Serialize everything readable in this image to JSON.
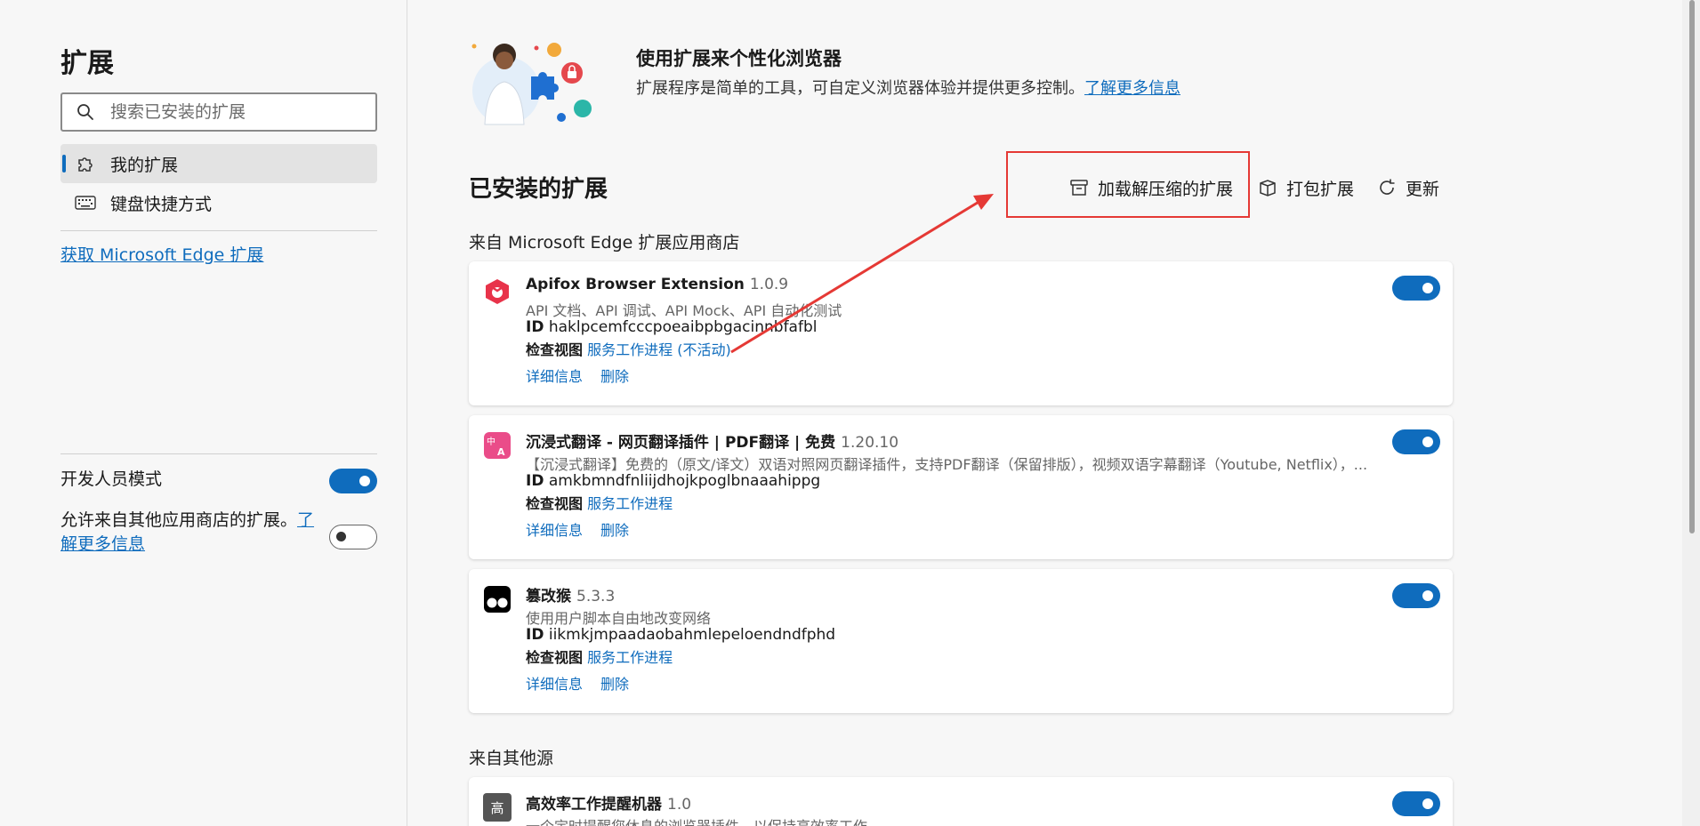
{
  "sidebar": {
    "title": "扩展",
    "search_placeholder": "搜索已安装的扩展",
    "nav": [
      {
        "label": "我的扩展",
        "icon": "puzzle-icon",
        "active": true
      },
      {
        "label": "键盘快捷方式",
        "icon": "keyboard-icon",
        "active": false
      }
    ],
    "get_extensions_link": "获取 Microsoft Edge 扩展",
    "developer_mode_label": "开发人员模式",
    "developer_mode_on": true,
    "allow_other_stores_text": "允许来自其他应用商店的扩展。",
    "allow_other_stores_link": "了解更多信息",
    "allow_other_stores_on": false
  },
  "hero": {
    "title": "使用扩展来个性化浏览器",
    "description": "扩展程序是简单的工具，可自定义浏览器体验并提供更多控制。",
    "learn_more": "了解更多信息"
  },
  "installed": {
    "title": "已安装的扩展",
    "actions": [
      {
        "label": "加载解压缩的扩展",
        "icon": "archive-icon"
      },
      {
        "label": "打包扩展",
        "icon": "package-icon"
      },
      {
        "label": "更新",
        "icon": "refresh-icon"
      }
    ]
  },
  "groups": {
    "store_label": "来自 Microsoft Edge 扩展应用商店",
    "other_label": "来自其他源"
  },
  "labels": {
    "id": "ID",
    "inspect": "检查视图",
    "details": "详细信息",
    "remove": "删除"
  },
  "extensions": [
    {
      "name": "Apifox Browser Extension",
      "version": "1.0.9",
      "description": "API 文档、API 调试、API Mock、API 自动化测试",
      "id": "haklpcemfcccpoeaibpbgacinnbfafbl",
      "inspect_link": "服务工作进程 (不活动)",
      "enabled": true,
      "logo_color": "#e8334a"
    },
    {
      "name": "沉浸式翻译 - 网页翻译插件 | PDF翻译 | 免费",
      "version": "1.20.10",
      "description": "【沉浸式翻译】免费的（原文/译文）双语对照网页翻译插件，支持PDF翻译（保留排版），视频双语字幕翻译（Youtube, Netflix），...",
      "id": "amkbmndfnliijdhojkpoglbnaaahippg",
      "inspect_link": "服务工作进程",
      "enabled": true,
      "logo_color": "#ea4c89"
    },
    {
      "name": "篡改猴",
      "version": "5.3.3",
      "description": "使用用户脚本自由地改变网络",
      "id": "iikmkjmpaadaobahmlepeloendndfphd",
      "inspect_link": "服务工作进程",
      "enabled": true,
      "logo_color": "#000000"
    },
    {
      "name": "高效率工作提醒机器",
      "version": "1.0",
      "description": "一个定时提醒您休息的浏览器插件，以保持高效率工作",
      "enabled": true,
      "logo_color": "#555555",
      "logo_text": "高"
    }
  ],
  "colors": {
    "accent": "#0f6cbd",
    "annotation": "#e53935"
  }
}
